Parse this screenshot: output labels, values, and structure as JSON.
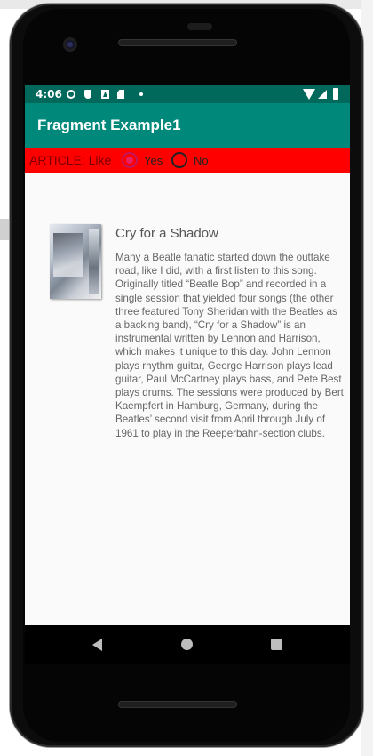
{
  "status_bar": {
    "time": "4:06",
    "icons": [
      "gear-icon",
      "shield-icon",
      "a-icon",
      "sd-card-icon",
      "dot-icon",
      "wifi-icon",
      "signal-icon",
      "battery-icon"
    ]
  },
  "app_bar": {
    "title": "Fragment Example1",
    "color": "#00897b"
  },
  "article_bar": {
    "label": "ARTICLE: Like",
    "background": "#ff0000",
    "options": [
      {
        "label": "Yes",
        "checked": true
      },
      {
        "label": "No",
        "checked": false
      }
    ]
  },
  "song": {
    "image": "album-cover",
    "title": "Cry for a Shadow",
    "description": "Many a Beatle fanatic started down the outtake road, like I did, with a first listen to this song. Originally titled “Beatle Bop” and recorded in a single session that yielded four songs (the other three featured Tony Sheridan with the Beatles as a backing band), “Cry for a Shadow” is an instrumental written by Lennon and Harrison, which makes it unique to this day. John Lennon plays rhythm guitar, George Harrison plays lead guitar, Paul McCartney plays bass, and Pete Best plays drums. The sessions were produced by Bert Kaempfert in Hamburg, Germany, during the Beatles’ second visit from April through July of 1961 to play in the Reeperbahn-section clubs."
  },
  "nav_bar": {
    "buttons": [
      "back-icon",
      "home-icon",
      "recents-icon"
    ]
  }
}
